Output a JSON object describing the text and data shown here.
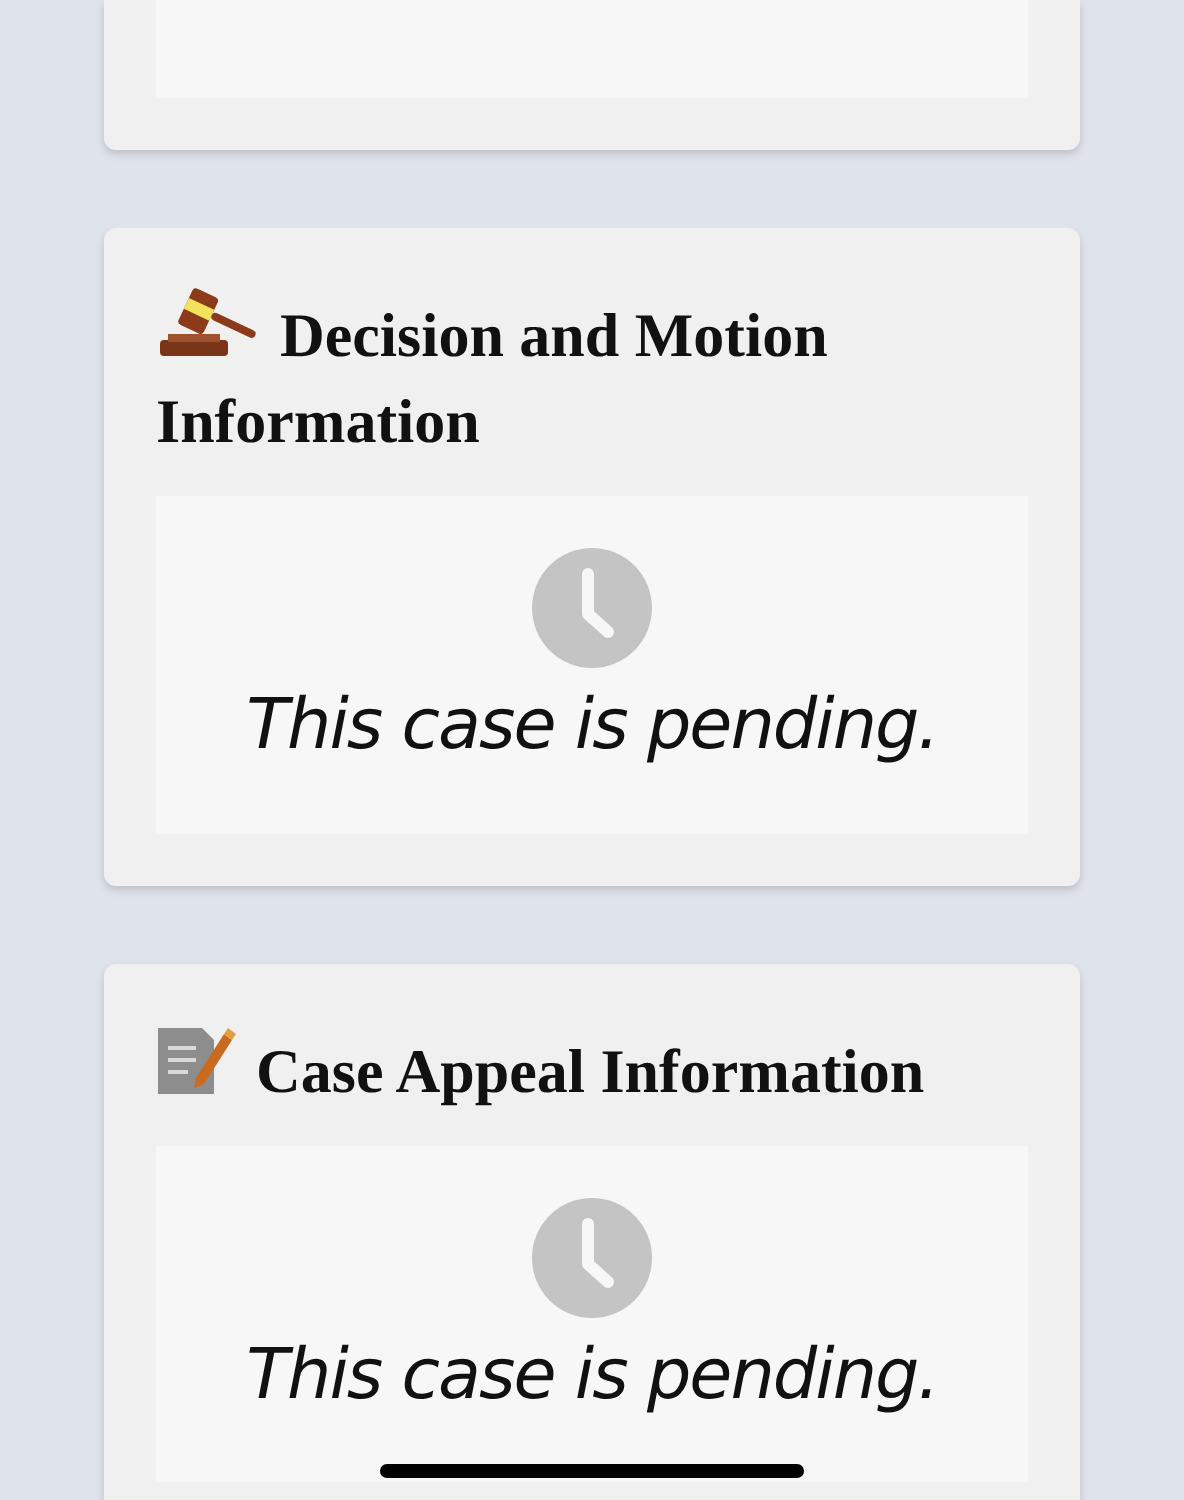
{
  "sections": [
    {
      "kind": "gavel",
      "title": "Decision and Motion Information",
      "status": {
        "kind": "pending",
        "message": "This case is pending."
      }
    },
    {
      "kind": "memo",
      "title": "Case Appeal Information",
      "status": {
        "kind": "pending",
        "message": "This case is pending."
      }
    }
  ]
}
